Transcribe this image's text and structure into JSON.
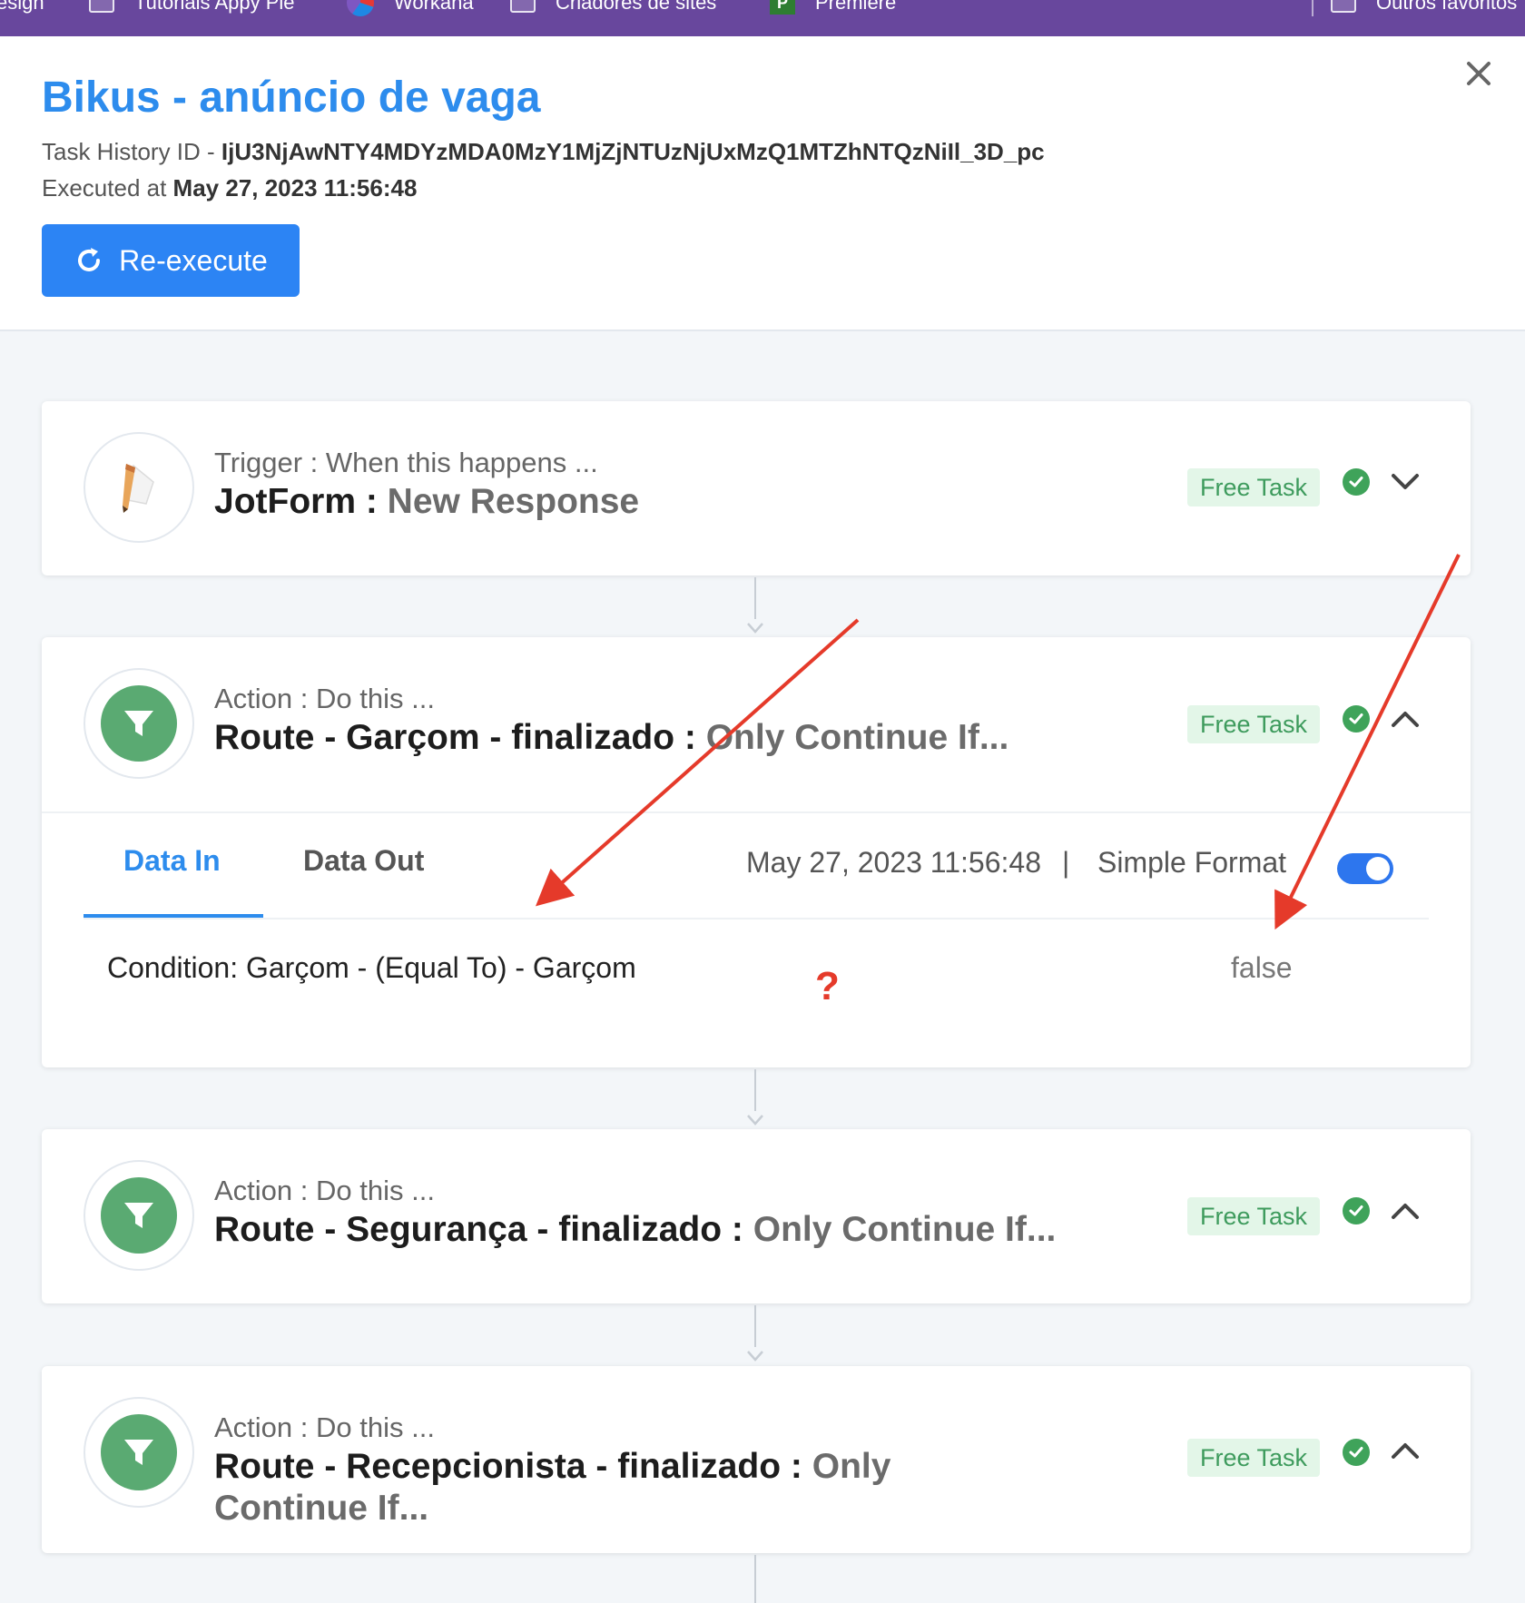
{
  "bookmarks": {
    "items": [
      {
        "label": "esign"
      },
      {
        "label": "Tutorials Appy Pie"
      },
      {
        "label": "Workana"
      },
      {
        "label": "Criadores de sites"
      },
      {
        "label": "Premiere"
      },
      {
        "label": "Outros favoritos"
      }
    ]
  },
  "header": {
    "title": "Bikus - anúncio de vaga",
    "task_history_label": "Task History ID - ",
    "task_history_id": "IjU3NjAwNTY4MDYzMDA0MzY1MjZjNTUzNjUxMzQ1MTZhNTQzNiIl_3D_pc",
    "executed_label": "Executed at ",
    "executed_at": "May 27, 2023 11:56:48",
    "reexecute_label": "Re-execute"
  },
  "steps": [
    {
      "kind": "Trigger : When this happens ...",
      "app": "JotForm : ",
      "event": "New Response",
      "badge": "Free Task",
      "icon": "jotform-pencil-icon",
      "status": "success",
      "expanded": false
    },
    {
      "kind": "Action : Do this ...",
      "app": "Route - Garçom - finalizado : ",
      "event": "Only Continue If...",
      "badge": "Free Task",
      "icon": "filter-icon",
      "status": "success",
      "expanded": true,
      "details": {
        "tab_in": "Data In",
        "tab_out": "Data Out",
        "timestamp": "May 27, 2023 11:56:48",
        "separator": "|",
        "format_label": "Simple Format",
        "condition_label": "Condition: Garçom - (Equal To) - Garçom",
        "condition_value": "false"
      }
    },
    {
      "kind": "Action : Do this ...",
      "app": "Route - Segurança - finalizado : ",
      "event": "Only Continue If...",
      "badge": "Free Task",
      "icon": "filter-icon",
      "status": "success",
      "expanded": false
    },
    {
      "kind": "Action : Do this ...",
      "app": "Route - Recepcionista - finalizado : ",
      "event": "Only Continue If...",
      "badge": "Free Task",
      "icon": "filter-icon",
      "status": "success",
      "expanded": false
    }
  ],
  "annotation": {
    "question_mark": "?",
    "arrow_color": "#e53a2a"
  },
  "colors": {
    "bookmark_bar": "#68479d",
    "accent_blue": "#2d8ced",
    "button_blue": "#2c84f4",
    "filter_green": "#5aaa72",
    "badge_bg": "#e3f6e8",
    "badge_text": "#3e9b5d",
    "check_green": "#3fa35a"
  }
}
